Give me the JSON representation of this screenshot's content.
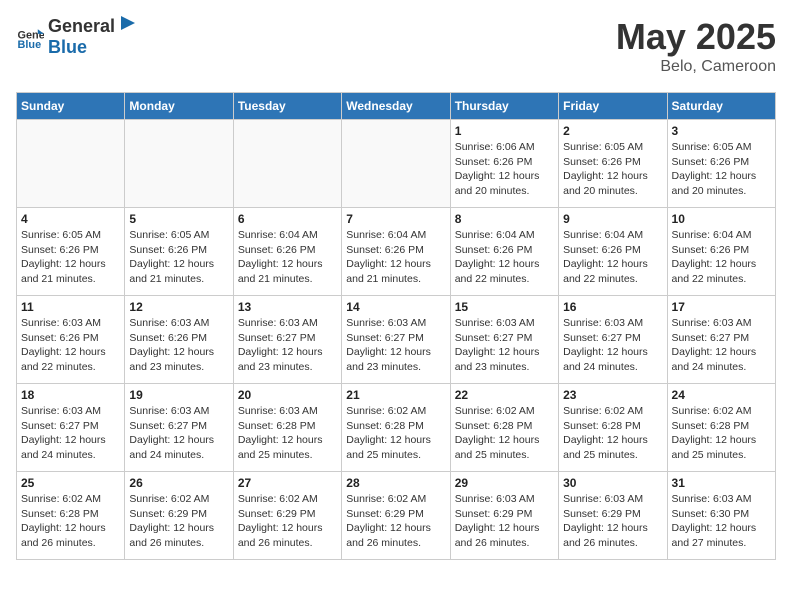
{
  "header": {
    "logo_general": "General",
    "logo_blue": "Blue",
    "main_title": "May 2025",
    "sub_title": "Belo, Cameroon"
  },
  "days_of_week": [
    "Sunday",
    "Monday",
    "Tuesday",
    "Wednesday",
    "Thursday",
    "Friday",
    "Saturday"
  ],
  "weeks": [
    [
      {
        "day": "",
        "info": ""
      },
      {
        "day": "",
        "info": ""
      },
      {
        "day": "",
        "info": ""
      },
      {
        "day": "",
        "info": ""
      },
      {
        "day": "1",
        "info": "Sunrise: 6:06 AM\nSunset: 6:26 PM\nDaylight: 12 hours\nand 20 minutes."
      },
      {
        "day": "2",
        "info": "Sunrise: 6:05 AM\nSunset: 6:26 PM\nDaylight: 12 hours\nand 20 minutes."
      },
      {
        "day": "3",
        "info": "Sunrise: 6:05 AM\nSunset: 6:26 PM\nDaylight: 12 hours\nand 20 minutes."
      }
    ],
    [
      {
        "day": "4",
        "info": "Sunrise: 6:05 AM\nSunset: 6:26 PM\nDaylight: 12 hours\nand 21 minutes."
      },
      {
        "day": "5",
        "info": "Sunrise: 6:05 AM\nSunset: 6:26 PM\nDaylight: 12 hours\nand 21 minutes."
      },
      {
        "day": "6",
        "info": "Sunrise: 6:04 AM\nSunset: 6:26 PM\nDaylight: 12 hours\nand 21 minutes."
      },
      {
        "day": "7",
        "info": "Sunrise: 6:04 AM\nSunset: 6:26 PM\nDaylight: 12 hours\nand 21 minutes."
      },
      {
        "day": "8",
        "info": "Sunrise: 6:04 AM\nSunset: 6:26 PM\nDaylight: 12 hours\nand 22 minutes."
      },
      {
        "day": "9",
        "info": "Sunrise: 6:04 AM\nSunset: 6:26 PM\nDaylight: 12 hours\nand 22 minutes."
      },
      {
        "day": "10",
        "info": "Sunrise: 6:04 AM\nSunset: 6:26 PM\nDaylight: 12 hours\nand 22 minutes."
      }
    ],
    [
      {
        "day": "11",
        "info": "Sunrise: 6:03 AM\nSunset: 6:26 PM\nDaylight: 12 hours\nand 22 minutes."
      },
      {
        "day": "12",
        "info": "Sunrise: 6:03 AM\nSunset: 6:26 PM\nDaylight: 12 hours\nand 23 minutes."
      },
      {
        "day": "13",
        "info": "Sunrise: 6:03 AM\nSunset: 6:27 PM\nDaylight: 12 hours\nand 23 minutes."
      },
      {
        "day": "14",
        "info": "Sunrise: 6:03 AM\nSunset: 6:27 PM\nDaylight: 12 hours\nand 23 minutes."
      },
      {
        "day": "15",
        "info": "Sunrise: 6:03 AM\nSunset: 6:27 PM\nDaylight: 12 hours\nand 23 minutes."
      },
      {
        "day": "16",
        "info": "Sunrise: 6:03 AM\nSunset: 6:27 PM\nDaylight: 12 hours\nand 24 minutes."
      },
      {
        "day": "17",
        "info": "Sunrise: 6:03 AM\nSunset: 6:27 PM\nDaylight: 12 hours\nand 24 minutes."
      }
    ],
    [
      {
        "day": "18",
        "info": "Sunrise: 6:03 AM\nSunset: 6:27 PM\nDaylight: 12 hours\nand 24 minutes."
      },
      {
        "day": "19",
        "info": "Sunrise: 6:03 AM\nSunset: 6:27 PM\nDaylight: 12 hours\nand 24 minutes."
      },
      {
        "day": "20",
        "info": "Sunrise: 6:03 AM\nSunset: 6:28 PM\nDaylight: 12 hours\nand 25 minutes."
      },
      {
        "day": "21",
        "info": "Sunrise: 6:02 AM\nSunset: 6:28 PM\nDaylight: 12 hours\nand 25 minutes."
      },
      {
        "day": "22",
        "info": "Sunrise: 6:02 AM\nSunset: 6:28 PM\nDaylight: 12 hours\nand 25 minutes."
      },
      {
        "day": "23",
        "info": "Sunrise: 6:02 AM\nSunset: 6:28 PM\nDaylight: 12 hours\nand 25 minutes."
      },
      {
        "day": "24",
        "info": "Sunrise: 6:02 AM\nSunset: 6:28 PM\nDaylight: 12 hours\nand 25 minutes."
      }
    ],
    [
      {
        "day": "25",
        "info": "Sunrise: 6:02 AM\nSunset: 6:28 PM\nDaylight: 12 hours\nand 26 minutes."
      },
      {
        "day": "26",
        "info": "Sunrise: 6:02 AM\nSunset: 6:29 PM\nDaylight: 12 hours\nand 26 minutes."
      },
      {
        "day": "27",
        "info": "Sunrise: 6:02 AM\nSunset: 6:29 PM\nDaylight: 12 hours\nand 26 minutes."
      },
      {
        "day": "28",
        "info": "Sunrise: 6:02 AM\nSunset: 6:29 PM\nDaylight: 12 hours\nand 26 minutes."
      },
      {
        "day": "29",
        "info": "Sunrise: 6:03 AM\nSunset: 6:29 PM\nDaylight: 12 hours\nand 26 minutes."
      },
      {
        "day": "30",
        "info": "Sunrise: 6:03 AM\nSunset: 6:29 PM\nDaylight: 12 hours\nand 26 minutes."
      },
      {
        "day": "31",
        "info": "Sunrise: 6:03 AM\nSunset: 6:30 PM\nDaylight: 12 hours\nand 27 minutes."
      }
    ]
  ]
}
